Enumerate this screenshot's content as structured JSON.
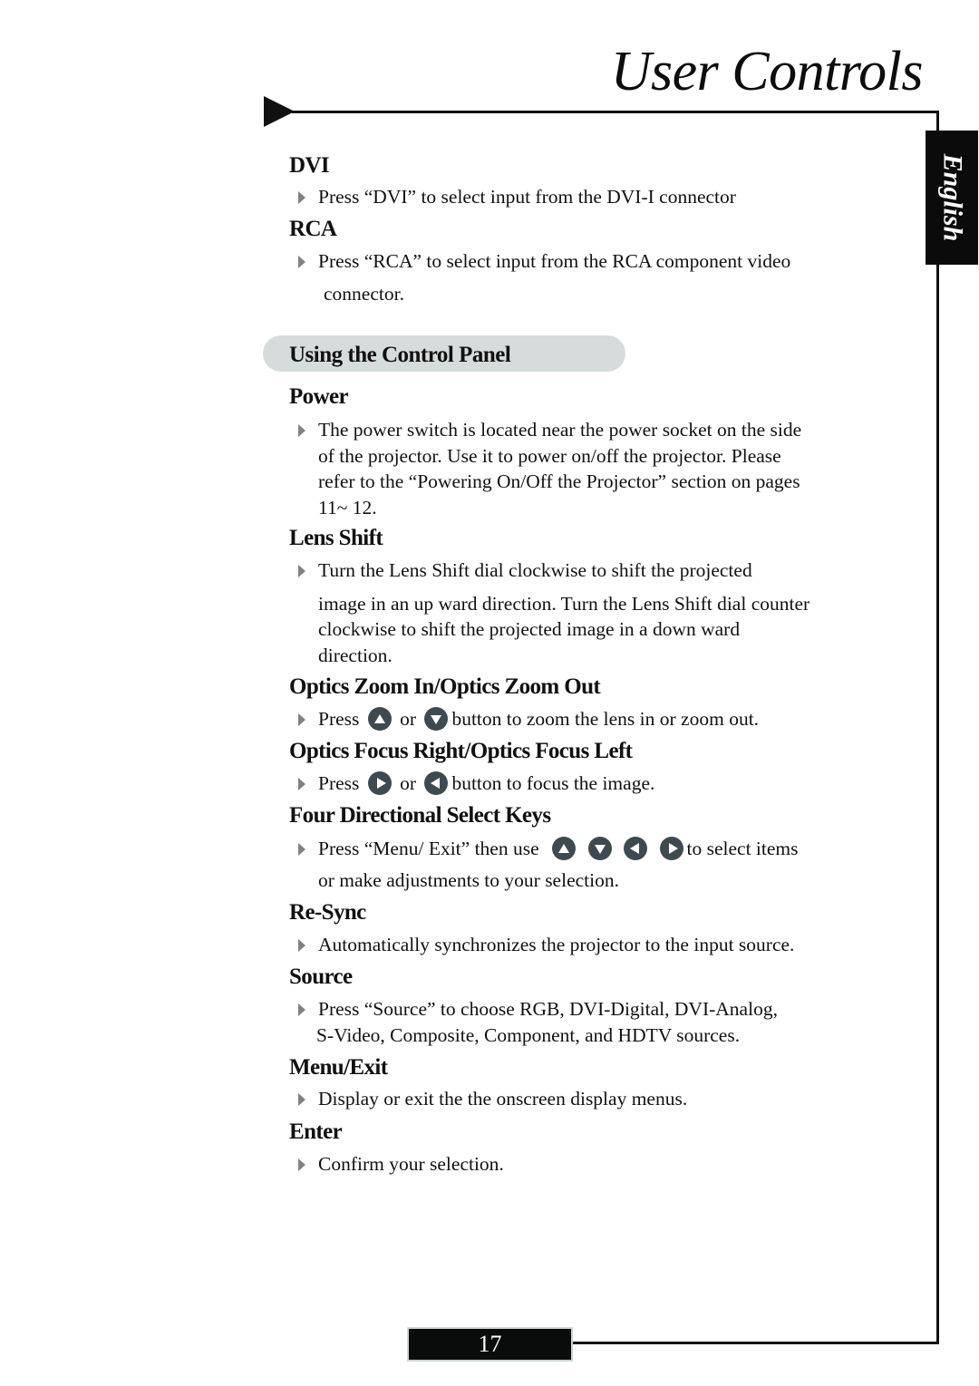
{
  "header": {
    "title": "User Controls",
    "language_tab": "English"
  },
  "sections": {
    "dvi": {
      "heading": "DVI",
      "bullet": "Press “DVI” to select input from the DVI-I connector"
    },
    "rca": {
      "heading": "RCA",
      "bullet_line1": "Press “RCA” to select input from the RCA component video",
      "bullet_line2": "connector."
    },
    "control_panel": {
      "title": "Using the Control Panel"
    },
    "power": {
      "heading": "Power",
      "lines": [
        "The power switch is located near the power socket on the side",
        "of the projector. Use it to power on/off the projector. Please",
        "refer to the “Powering  On/Off the  Projector” section on pages",
        "11~ 12."
      ]
    },
    "lens_shift": {
      "heading": "Lens Shift",
      "lines": [
        "Turn the Lens Shift dial clockwise to shift the projected",
        "image in an up ward direction. Turn the Lens Shift dial counter",
        "clockwise to shift the  projected image in a down ward",
        "direction."
      ]
    },
    "optics_zoom": {
      "heading": "Optics Zoom In/Optics Zoom Out",
      "press": "Press",
      "or": "or",
      "rest": "button to zoom the lens in or zoom out.",
      "icons": [
        "up-arrow-button-icon",
        "down-arrow-button-icon"
      ]
    },
    "optics_focus": {
      "heading": "Optics Focus Right/Optics Focus Left",
      "press": "Press",
      "or": "or",
      "rest": "button to focus the image.",
      "icons": [
        "right-arrow-button-icon",
        "left-arrow-button-icon"
      ]
    },
    "four_directional": {
      "heading": "Four Directional Select Keys",
      "line1_start": "Press “Menu/ Exit” then use",
      "line1_end": "to select items",
      "line2": "or make adjustments to your selection.",
      "icons": [
        "up-arrow-button-icon",
        "down-arrow-button-icon",
        "left-arrow-button-icon",
        "right-arrow-button-icon"
      ]
    },
    "resync": {
      "heading": "Re-Sync",
      "bullet": "Automatically synchronizes the projector to the input source."
    },
    "source": {
      "heading": "Source",
      "lines": [
        "Press “Source” to choose RGB, DVI-Digital, DVI-Analog,",
        "S-Video, Composite, Component, and HDTV sources."
      ]
    },
    "menu_exit": {
      "heading": "Menu/Exit",
      "bullet": "Display or exit the the onscreen display menus."
    },
    "enter": {
      "heading": "Enter",
      "bullet": "Confirm your selection."
    }
  },
  "footer": {
    "page_number": "17"
  },
  "colors": {
    "pill_background": "#d6dcdb",
    "button_icon": "#3e4a4f",
    "bullet_marker": "#7d8283",
    "rule": "#111111"
  }
}
